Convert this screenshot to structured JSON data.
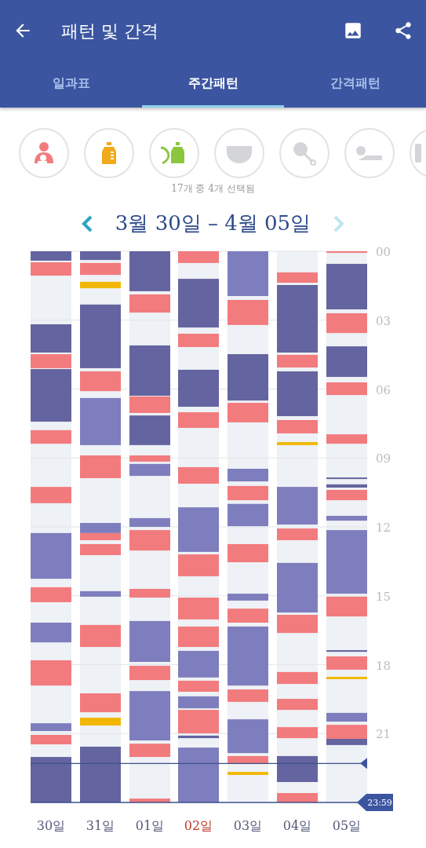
{
  "app_bar": {
    "title": "패턴 및 간격"
  },
  "tabs": [
    {
      "label": "일과표",
      "selected": false
    },
    {
      "label": "주간패턴",
      "selected": true
    },
    {
      "label": "간격패턴",
      "selected": false
    }
  ],
  "filters": {
    "items": [
      {
        "kind": "breastfeeding",
        "selected": true
      },
      {
        "kind": "bottle",
        "selected": true
      },
      {
        "kind": "pumping",
        "selected": true
      },
      {
        "kind": "diaper",
        "selected": false
      },
      {
        "kind": "rattle",
        "selected": false
      },
      {
        "kind": "tummy",
        "selected": false
      },
      {
        "kind": "other",
        "selected": false
      }
    ],
    "caption": "17개 중 4개 선택됨"
  },
  "week_nav": {
    "range": "3월 30일 – 4월 05일"
  },
  "weekly_chart": {
    "hour_labels": [
      "00",
      "03",
      "06",
      "09",
      "12",
      "15",
      "18",
      "21"
    ],
    "end_label": "23:59",
    "days": [
      {
        "label": "30일",
        "highlighted": false
      },
      {
        "label": "31일",
        "highlighted": false
      },
      {
        "label": "01일",
        "highlighted": false
      },
      {
        "label": "02일",
        "highlighted": true
      },
      {
        "label": "03일",
        "highlighted": false
      },
      {
        "label": "04일",
        "highlighted": false
      },
      {
        "label": "05일",
        "highlighted": false
      }
    ]
  }
}
